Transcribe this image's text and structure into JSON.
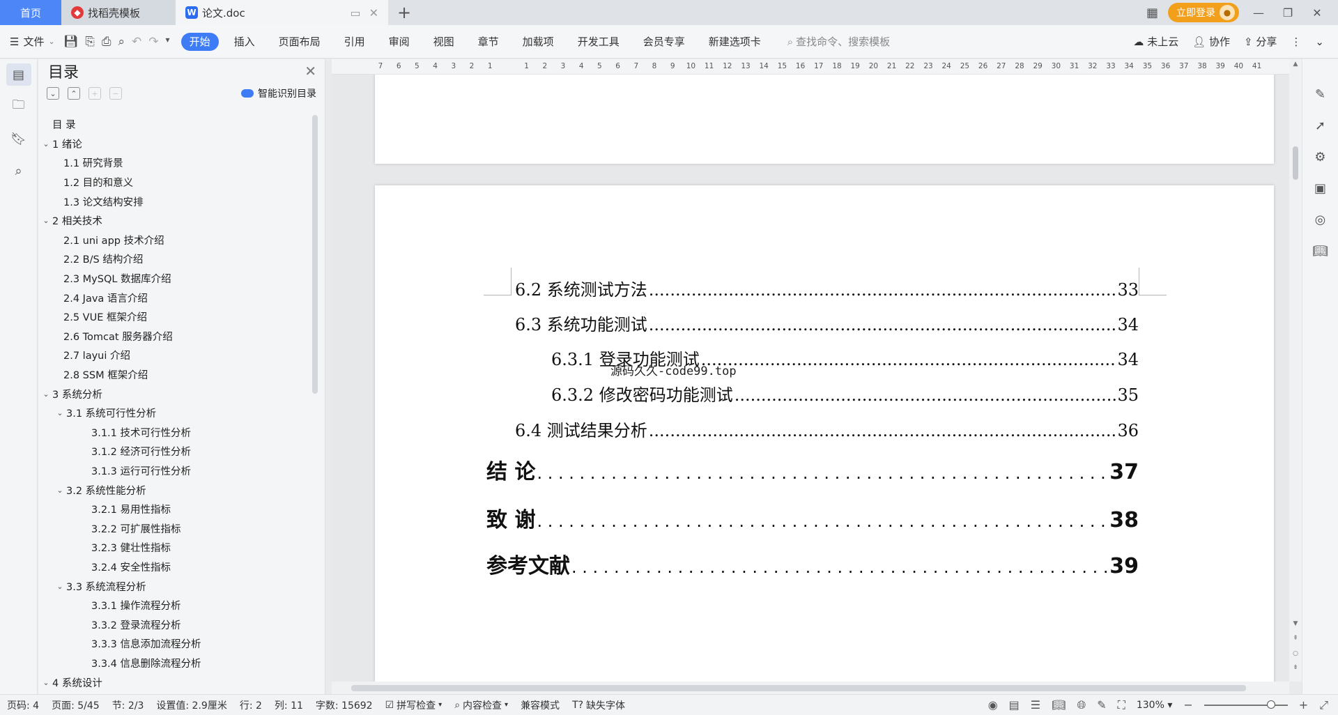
{
  "tabs": {
    "home": "首页",
    "daoke": "找稻壳模板",
    "doc": "论文.doc",
    "login": "立即登录"
  },
  "ribbon": {
    "file": "文件",
    "tabs": [
      "开始",
      "插入",
      "页面布局",
      "引用",
      "审阅",
      "视图",
      "章节",
      "加载项",
      "开发工具",
      "会员专享",
      "新建选项卡"
    ],
    "search_placeholder": "查找命令、搜索模板",
    "cloud": "未上云",
    "collab": "协作",
    "share": "分享"
  },
  "nav": {
    "title": "目录",
    "ai_label": "智能识别目录",
    "items": [
      {
        "text": "目  录",
        "level": 1,
        "chevron": false
      },
      {
        "text": "1  绪论",
        "level": 0,
        "chevron": true
      },
      {
        "text": "1.1  研究背景",
        "level": 1,
        "chevron": false
      },
      {
        "text": "1.2  目的和意义",
        "level": 1,
        "chevron": false
      },
      {
        "text": "1.3  论文结构安排",
        "level": 1,
        "chevron": false
      },
      {
        "text": "2  相关技术",
        "level": 0,
        "chevron": true
      },
      {
        "text": "2.1 uni app 技术介绍",
        "level": 1,
        "chevron": false
      },
      {
        "text": "2.2 B/S 结构介绍",
        "level": 1,
        "chevron": false
      },
      {
        "text": "2.3 MySQL 数据库介绍",
        "level": 1,
        "chevron": false
      },
      {
        "text": "2.4 Java 语言介绍",
        "level": 1,
        "chevron": false
      },
      {
        "text": "2.5 VUE 框架介绍",
        "level": 1,
        "chevron": false
      },
      {
        "text": "2.6 Tomcat 服务器介绍",
        "level": 1,
        "chevron": false
      },
      {
        "text": "2.7 layui 介绍",
        "level": 1,
        "chevron": false
      },
      {
        "text": "2.8 SSM 框架介绍",
        "level": 1,
        "chevron": false
      },
      {
        "text": "3  系统分析",
        "level": 0,
        "chevron": true
      },
      {
        "text": "3.1  系统可行性分析",
        "level": 1,
        "chevron": true
      },
      {
        "text": "3.1.1  技术可行性分析",
        "level": 2,
        "chevron": false
      },
      {
        "text": "3.1.2  经济可行性分析",
        "level": 2,
        "chevron": false
      },
      {
        "text": "3.1.3  运行可行性分析",
        "level": 2,
        "chevron": false
      },
      {
        "text": "3.2  系统性能分析",
        "level": 1,
        "chevron": true
      },
      {
        "text": "3.2.1  易用性指标",
        "level": 2,
        "chevron": false
      },
      {
        "text": "3.2.2  可扩展性指标",
        "level": 2,
        "chevron": false
      },
      {
        "text": "3.2.3  健壮性指标",
        "level": 2,
        "chevron": false
      },
      {
        "text": "3.2.4  安全性指标",
        "level": 2,
        "chevron": false
      },
      {
        "text": "3.3  系统流程分析",
        "level": 1,
        "chevron": true
      },
      {
        "text": "3.3.1  操作流程分析",
        "level": 2,
        "chevron": false
      },
      {
        "text": "3.3.2  登录流程分析",
        "level": 2,
        "chevron": false
      },
      {
        "text": "3.3.3  信息添加流程分析",
        "level": 2,
        "chevron": false
      },
      {
        "text": "3.3.4  信息删除流程分析",
        "level": 2,
        "chevron": false
      },
      {
        "text": "4  系统设计",
        "level": 0,
        "chevron": true
      }
    ]
  },
  "ruler": [
    "7",
    "6",
    "5",
    "4",
    "3",
    "2",
    "1",
    "",
    "1",
    "2",
    "3",
    "4",
    "5",
    "6",
    "7",
    "8",
    "9",
    "10",
    "11",
    "12",
    "13",
    "14",
    "15",
    "16",
    "17",
    "18",
    "19",
    "20",
    "21",
    "22",
    "23",
    "24",
    "25",
    "26",
    "27",
    "28",
    "29",
    "30",
    "31",
    "32",
    "33",
    "34",
    "35",
    "36",
    "37",
    "38",
    "39",
    "40",
    "41"
  ],
  "doc": {
    "watermark": "源码久久-code99.top",
    "lines": [
      {
        "label": "6.2  系统测试方法",
        "page": "33",
        "kind": "sub",
        "indent": 0
      },
      {
        "label": "6.3  系统功能测试",
        "page": "34",
        "kind": "sub",
        "indent": 0
      },
      {
        "label": "6.3.1  登录功能测试",
        "page": "34",
        "kind": "sub",
        "indent": 1
      },
      {
        "label": "6.3.2  修改密码功能测试",
        "page": "35",
        "kind": "sub",
        "indent": 1
      },
      {
        "label": "6.4  测试结果分析",
        "page": "36",
        "kind": "sub",
        "indent": 0
      },
      {
        "label": "结    论",
        "page": "37",
        "kind": "big",
        "indent": -1
      },
      {
        "label": "致    谢",
        "page": "38",
        "kind": "big",
        "indent": -1
      },
      {
        "label": "参考文献",
        "page": "39",
        "kind": "big",
        "indent": -1
      }
    ]
  },
  "status": {
    "page_num": "页码: 4",
    "page": "页面: 5/45",
    "section": "节: 2/3",
    "setting": "设置值: 2.9厘米",
    "row": "行: 2",
    "col": "列: 11",
    "words": "字数: 15692",
    "spell": "拼写检查",
    "content_check": "内容检查",
    "compat": "兼容模式",
    "missing_font": "缺失字体",
    "zoom": "130%"
  }
}
